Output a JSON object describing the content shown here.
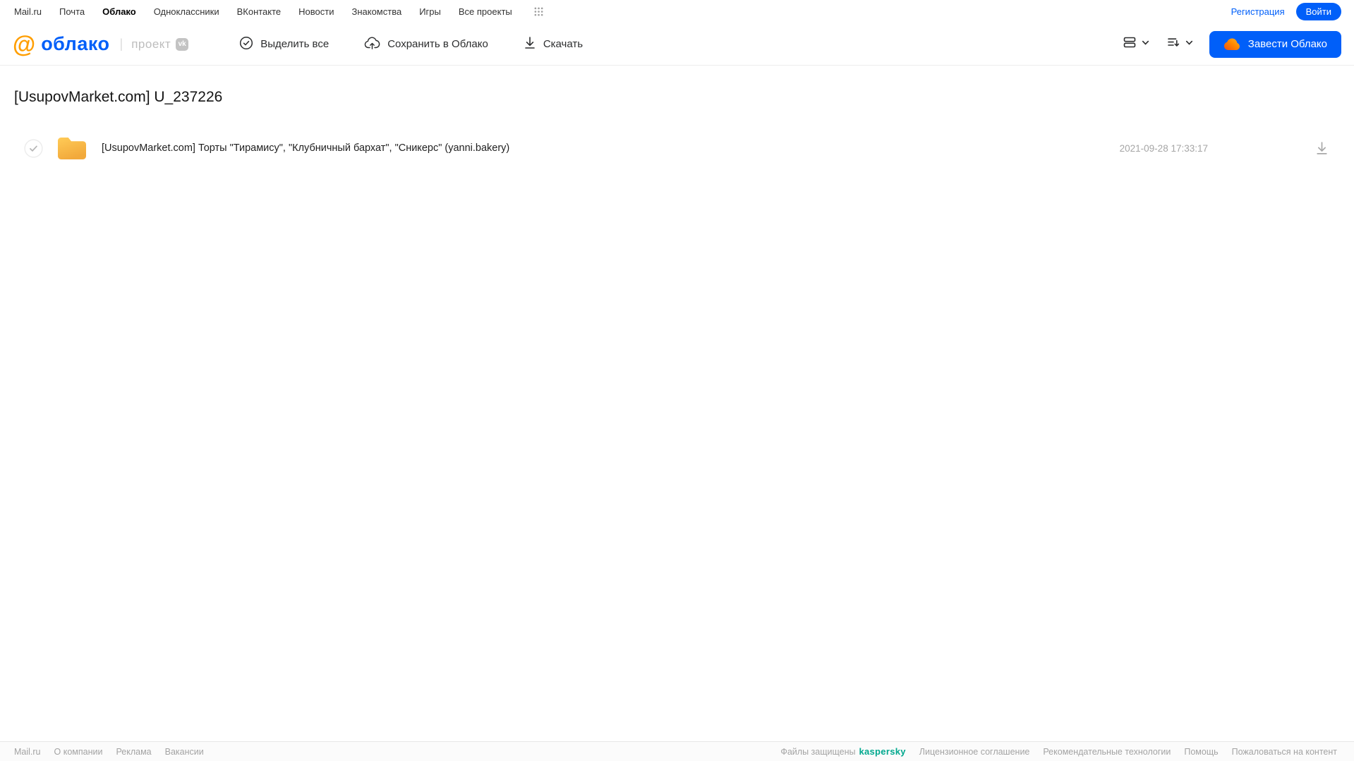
{
  "colors": {
    "accent_blue": "#005FF9",
    "logo_orange": "#FF9E00",
    "folder_yellow_top": "#FFCB57",
    "folder_yellow_bottom": "#F2A93B",
    "kaspersky_green": "#00A88E"
  },
  "top_nav": {
    "items": [
      {
        "label": "Mail.ru"
      },
      {
        "label": "Почта"
      },
      {
        "label": "Облако",
        "active": true
      },
      {
        "label": "Одноклассники"
      },
      {
        "label": "ВКонтакте"
      },
      {
        "label": "Новости"
      },
      {
        "label": "Знакомства"
      },
      {
        "label": "Игры"
      },
      {
        "label": "Все проекты"
      }
    ],
    "registration_label": "Регистрация",
    "login_label": "Войти"
  },
  "header": {
    "logo_at": "@",
    "logo_text": "облако",
    "project_label": "проект",
    "vk_badge": "vk",
    "toolbar": {
      "select_all_label": "Выделить все",
      "save_to_cloud_label": "Сохранить в Облако",
      "download_label": "Скачать"
    },
    "get_cloud_label": "Завести Облако"
  },
  "main": {
    "title": "[UsupovMarket.com] U_237226",
    "files": [
      {
        "type": "folder",
        "name": "[UsupovMarket.com] Торты \"Тирамису\", \"Клубничный бархат\", \"Сникерс\" (yanni.bakery)",
        "date": "2021-09-28 17:33:17"
      }
    ]
  },
  "footer": {
    "left_links": [
      "Mail.ru",
      "О компании",
      "Реклама",
      "Вакансии"
    ],
    "protected_text": "Файлы защищены",
    "kaspersky_label": "kaspersky",
    "right_links": [
      "Лицензионное соглашение",
      "Рекомендательные технологии",
      "Помощь",
      "Пожаловаться на контент"
    ]
  }
}
